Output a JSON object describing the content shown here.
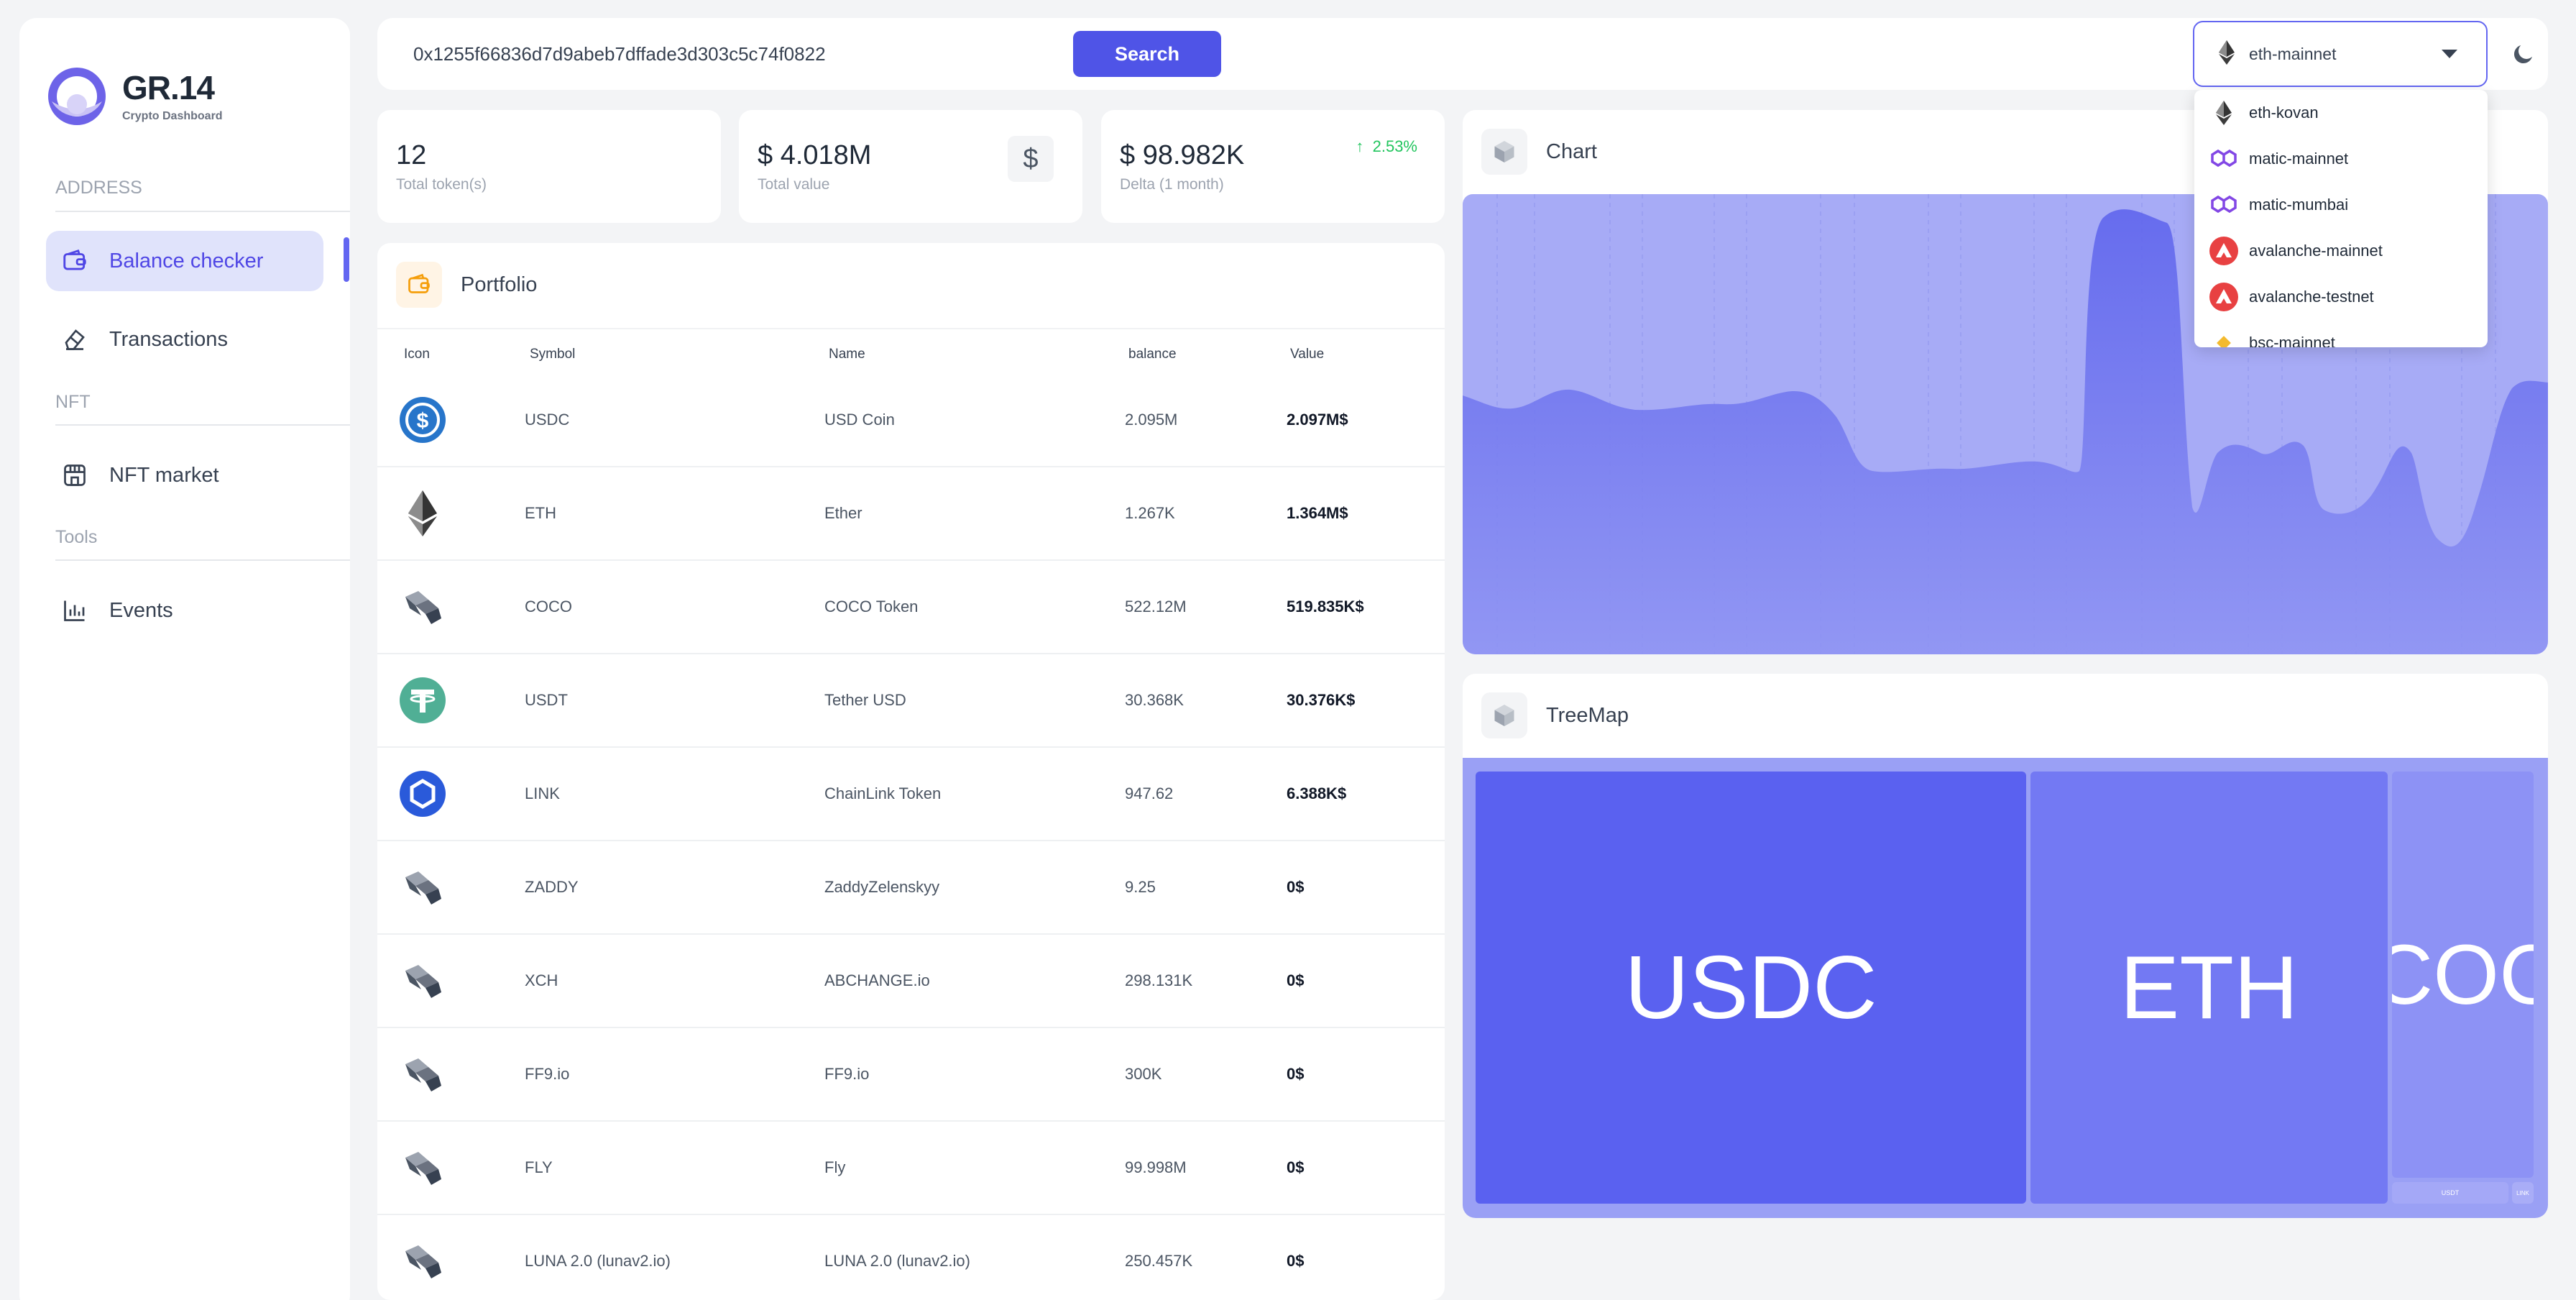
{
  "brand": {
    "name": "GR.14",
    "tagline": "Crypto Dashboard"
  },
  "sidebar": {
    "sections": [
      {
        "label": "ADDRESS"
      },
      {
        "label": "NFT"
      },
      {
        "label": "Tools"
      }
    ],
    "items": [
      {
        "label": "Balance checker",
        "icon": "wallet-icon",
        "active": true
      },
      {
        "label": "Transactions",
        "icon": "eraser-icon",
        "active": false
      },
      {
        "label": "NFT market",
        "icon": "store-icon",
        "active": false
      },
      {
        "label": "Events",
        "icon": "bar-chart-icon",
        "active": false
      }
    ]
  },
  "search": {
    "value": "0x1255f66836d7d9abeb7dffade3d303c5c74f0822",
    "button_label": "Search"
  },
  "network": {
    "selected": "eth-mainnet",
    "options": [
      {
        "label": "eth-kovan",
        "icon": "ethereum-icon"
      },
      {
        "label": "matic-mainnet",
        "icon": "polygon-icon"
      },
      {
        "label": "matic-mumbai",
        "icon": "polygon-icon"
      },
      {
        "label": "avalanche-mainnet",
        "icon": "avalanche-icon"
      },
      {
        "label": "avalanche-testnet",
        "icon": "avalanche-icon"
      },
      {
        "label": "bsc-mainnet",
        "icon": "binance-icon"
      }
    ]
  },
  "stats": {
    "tokens": {
      "value": "12",
      "label": "Total token(s)"
    },
    "total": {
      "value": "$ 4.018M",
      "label": "Total value"
    },
    "delta": {
      "value": "$ 98.982K",
      "label": "Delta (1 month)",
      "change": "2.53%"
    }
  },
  "portfolio": {
    "title": "Portfolio",
    "columns": [
      "Icon",
      "Symbol",
      "Name",
      "balance",
      "Value"
    ],
    "rows": [
      {
        "icon": "usdc-icon",
        "symbol": "USDC",
        "name": "USD Coin",
        "balance": "2.095M",
        "value": "2.097M$"
      },
      {
        "icon": "ethereum-icon",
        "symbol": "ETH",
        "name": "Ether",
        "balance": "1.267K",
        "value": "1.364M$"
      },
      {
        "icon": "generic-token-icon",
        "symbol": "COCO",
        "name": "COCO Token",
        "balance": "522.12M",
        "value": "519.835K$"
      },
      {
        "icon": "tether-icon",
        "symbol": "USDT",
        "name": "Tether USD",
        "balance": "30.368K",
        "value": "30.376K$"
      },
      {
        "icon": "chainlink-icon",
        "symbol": "LINK",
        "name": "ChainLink Token",
        "balance": "947.62",
        "value": "6.388K$"
      },
      {
        "icon": "generic-token-icon",
        "symbol": "ZADDY",
        "name": "ZaddyZelenskyy",
        "balance": "9.25",
        "value": "0$"
      },
      {
        "icon": "generic-token-icon",
        "symbol": "XCH",
        "name": "ABCHANGE.io",
        "balance": "298.131K",
        "value": "0$"
      },
      {
        "icon": "generic-token-icon",
        "symbol": "FF9.io",
        "name": "FF9.io",
        "balance": "300K",
        "value": "0$"
      },
      {
        "icon": "generic-token-icon",
        "symbol": "FLY",
        "name": "Fly",
        "balance": "99.998M",
        "value": "0$"
      },
      {
        "icon": "generic-token-icon",
        "symbol": "LUNA 2.0 (lunav2.io)",
        "name": "LUNA 2.0 (lunav2.io)",
        "balance": "250.457K",
        "value": "0$"
      }
    ]
  },
  "chart": {
    "title": "Chart",
    "icon": "cube-icon"
  },
  "treemap": {
    "title": "TreeMap",
    "icon": "cube-icon",
    "tiles": [
      {
        "label": "USDC"
      },
      {
        "label": "ETH"
      },
      {
        "label": "COCO"
      },
      {
        "label": "USDT"
      },
      {
        "label": "LINK"
      }
    ]
  },
  "colors": {
    "accent": "#4f54e7",
    "sidebar_active_bg": "#e0e3fb",
    "chart_fill_light": "#a6aaf6",
    "chart_fill_dark": "#6a70f0",
    "positive": "#22c55e"
  }
}
